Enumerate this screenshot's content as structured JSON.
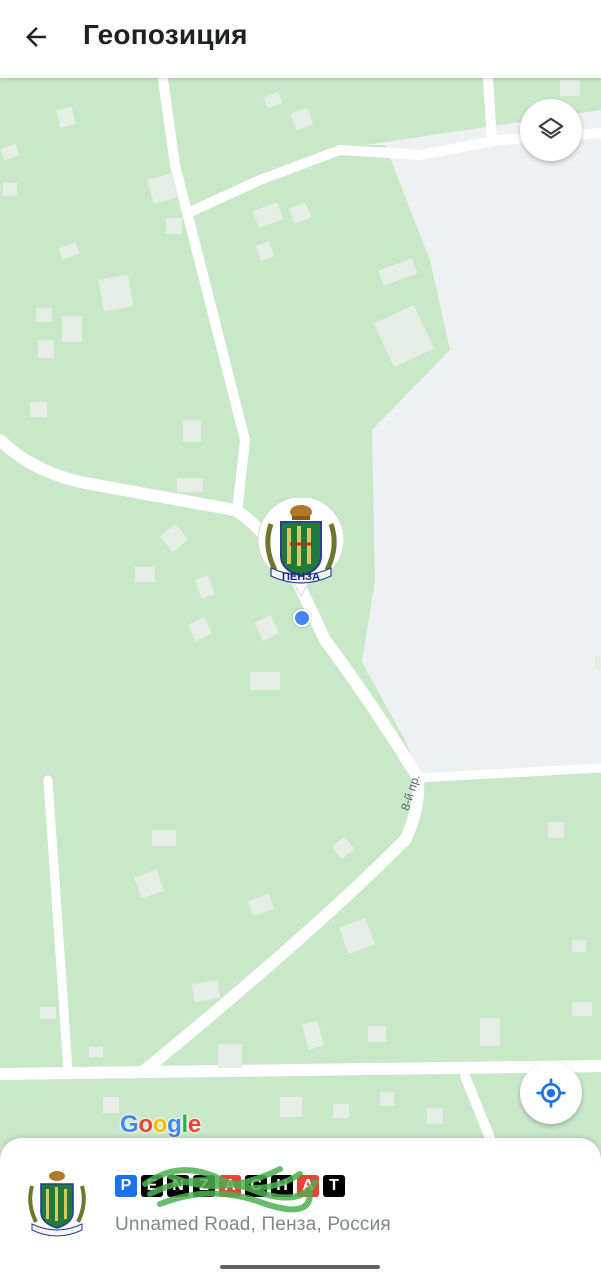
{
  "header": {
    "title": "Геопозиция",
    "back_icon": "arrow-back-icon"
  },
  "map": {
    "road_label": "8-й пр.",
    "watermark": "Google",
    "colors": {
      "land": "#c8e8c8",
      "road": "#ffffff",
      "building": "#e6ece6",
      "area": "#eef0f1",
      "user_dot": "#4285f4"
    },
    "buttons": {
      "layers_icon": "layers-icon",
      "locate_icon": "my-location-icon"
    },
    "marker": {
      "label": "ПЕНЗА",
      "icon": "coat-of-arms-icon"
    }
  },
  "place": {
    "name_tiles": [
      "P",
      "E",
      "N",
      "Z",
      "A",
      "C",
      "H",
      "A",
      "T"
    ],
    "name_tile_colors": [
      "#1a73e8",
      "#000000",
      "#000000",
      "#000000",
      "#ea4335",
      "#000000",
      "#000000",
      "#ea4335",
      "#000000"
    ],
    "address": "Unnamed Road, Пенза, Россия"
  }
}
